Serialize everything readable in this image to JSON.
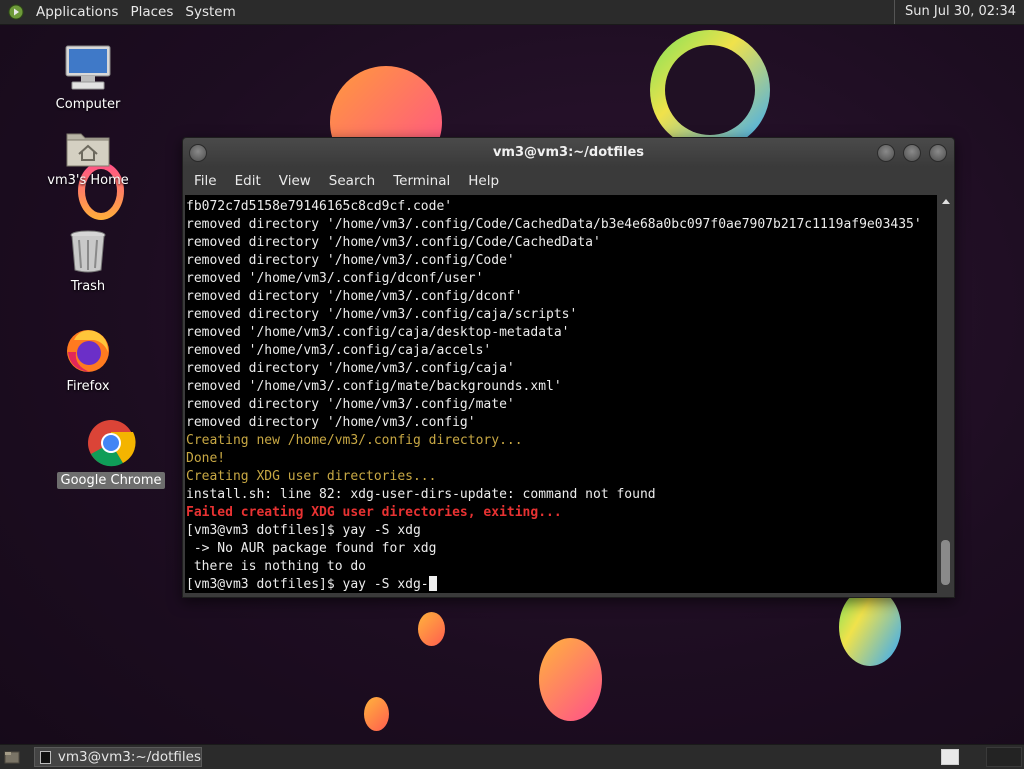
{
  "top_panel": {
    "menus": [
      "Applications",
      "Places",
      "System"
    ],
    "clock": "Sun Jul 30, 02:34"
  },
  "desktop_icons": [
    {
      "label": "Computer",
      "icon": "computer-icon"
    },
    {
      "label": "vm3's Home",
      "icon": "home-folder-icon"
    },
    {
      "label": "Trash",
      "icon": "trash-icon"
    },
    {
      "label": "Firefox",
      "icon": "firefox-icon"
    },
    {
      "label": "Google Chrome",
      "icon": "chrome-icon"
    }
  ],
  "terminal": {
    "title": "vm3@vm3:~/dotfiles",
    "menu": [
      "File",
      "Edit",
      "View",
      "Search",
      "Terminal",
      "Help"
    ],
    "lines": [
      {
        "text": "fb072c7d5158e79146165c8cd9cf.code'",
        "style": "normal"
      },
      {
        "text": "removed directory '/home/vm3/.config/Code/CachedData/b3e4e68a0bc097f0ae7907b217c1119af9e03435'",
        "style": "normal"
      },
      {
        "text": "removed directory '/home/vm3/.config/Code/CachedData'",
        "style": "normal"
      },
      {
        "text": "removed directory '/home/vm3/.config/Code'",
        "style": "normal"
      },
      {
        "text": "removed '/home/vm3/.config/dconf/user'",
        "style": "normal"
      },
      {
        "text": "removed directory '/home/vm3/.config/dconf'",
        "style": "normal"
      },
      {
        "text": "removed directory '/home/vm3/.config/caja/scripts'",
        "style": "normal"
      },
      {
        "text": "removed '/home/vm3/.config/caja/desktop-metadata'",
        "style": "normal"
      },
      {
        "text": "removed '/home/vm3/.config/caja/accels'",
        "style": "normal"
      },
      {
        "text": "removed directory '/home/vm3/.config/caja'",
        "style": "normal"
      },
      {
        "text": "removed '/home/vm3/.config/mate/backgrounds.xml'",
        "style": "normal"
      },
      {
        "text": "removed directory '/home/vm3/.config/mate'",
        "style": "normal"
      },
      {
        "text": "removed directory '/home/vm3/.config'",
        "style": "normal"
      },
      {
        "text": "Creating new /home/vm3/.config directory...",
        "style": "yellow"
      },
      {
        "text": "Done!",
        "style": "yellow"
      },
      {
        "text": "Creating XDG user directories...",
        "style": "yellow"
      },
      {
        "text": "install.sh: line 82: xdg-user-dirs-update: command not found",
        "style": "normal"
      },
      {
        "text": "Failed creating XDG user directories, exiting...",
        "style": "red"
      },
      {
        "text": "[vm3@vm3 dotfiles]$ yay -S xdg",
        "style": "normal"
      },
      {
        "text": " -> No AUR package found for xdg",
        "style": "normal"
      },
      {
        "text": " there is nothing to do",
        "style": "normal"
      },
      {
        "text": "[vm3@vm3 dotfiles]$ yay -S xdg-",
        "style": "prompt"
      }
    ]
  },
  "bottom_panel": {
    "task_label": "vm3@vm3:~/dotfiles"
  },
  "colors": {
    "terminal_bg": "#000000",
    "terminal_fg": "#ececec",
    "warning_yellow": "#c8a844",
    "error_red": "#e83232",
    "panel_bg": "#2b2b2b"
  }
}
